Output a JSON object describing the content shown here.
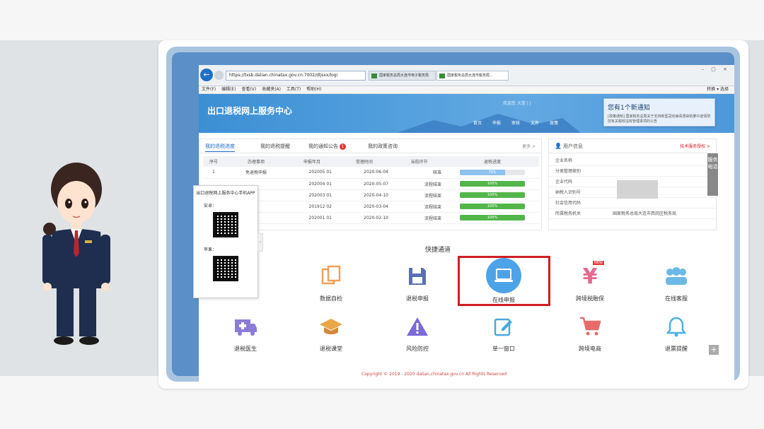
{
  "browser": {
    "url": "https://txsb.dalian.chinatax.gov.cn:7002/dljsxx/logi",
    "tabs": [
      "国家税务总局大连市电子税务局",
      "国家税务总局大连市税务局..."
    ],
    "menu": [
      "文件(F)",
      "编辑(E)",
      "查看(V)",
      "收藏夹(A)",
      "工具(T)",
      "帮助(H)"
    ],
    "menu_right": "转换 ▾  选择"
  },
  "site": {
    "title": "出口退税网上服务中心",
    "header_links": "欢迎您    大连    |    |    ",
    "nav": [
      "首页",
      "申报",
      "审核",
      "文件",
      "政策"
    ]
  },
  "notify": {
    "title": "您有1个新通知",
    "body": "[政策通知] 国家税务总局关于支持新型冠状病毒感染的肺炎疫情防控有关税收征收管理事项的公告"
  },
  "progress": {
    "tabs": [
      "我的退税进度",
      "我的退税提醒",
      "我的通知公告",
      "我的政策咨询"
    ],
    "badge": "1",
    "more": "更多 >",
    "headers": [
      "序号",
      "办理事项",
      "申报年月",
      "受理时间",
      "当前环节",
      "退税进度"
    ],
    "rows": [
      {
        "no": "1",
        "item": "免退税申报",
        "ym": "202005 01",
        "date": "2020-06-04",
        "stage": "核准",
        "pct": 70,
        "pct_label": "70%"
      },
      {
        "no": "",
        "item": "",
        "ym": "202004 01",
        "date": "2020-05-07",
        "stage": "流程结束",
        "pct": 100,
        "pct_label": "100%"
      },
      {
        "no": "",
        "item": "",
        "ym": "202003 01",
        "date": "2020-04-10",
        "stage": "流程结束",
        "pct": 100,
        "pct_label": "100%"
      },
      {
        "no": "",
        "item": "",
        "ym": "201912 02",
        "date": "2020-03-04",
        "stage": "流程结束",
        "pct": 100,
        "pct_label": "100%"
      },
      {
        "no": "",
        "item": "",
        "ym": "202001 01",
        "date": "2020-02-10",
        "stage": "流程结束",
        "pct": 100,
        "pct_label": "100%"
      }
    ]
  },
  "user": {
    "title": "用户信息",
    "link": "技术服务授权 >",
    "fields": [
      {
        "label": "企业名称",
        "value": ""
      },
      {
        "label": "分类管理类别",
        "value": ""
      },
      {
        "label": "企业代码",
        "value": ""
      },
      {
        "label": "纳税人识别号",
        "value": ""
      },
      {
        "label": "社会信用代码",
        "value": ""
      },
      {
        "label": "所属税务机关",
        "value": "国家税务总局大连市西岗区税务局"
      }
    ]
  },
  "side_tab": "服务电话",
  "qr": {
    "title": "出口退税网上服务中心手机APP",
    "android": "安卓：",
    "apple": "苹果："
  },
  "quick": {
    "title": "快捷通道",
    "items": [
      {
        "label": "数据自检",
        "icon": "copy-icon",
        "color": "#f0a25b"
      },
      {
        "label": "退税申报",
        "icon": "floppy-icon",
        "color": "#5a6fb0"
      },
      {
        "label": "在线申报",
        "icon": "laptop-icon",
        "color": "#4da3e8"
      },
      {
        "label": "跨境税融保",
        "icon": "yuan-icon",
        "color": "#e56a8d"
      },
      {
        "label": "在线客服",
        "icon": "people-icon",
        "color": "#6cb8e6"
      },
      {
        "label": "退税医生",
        "icon": "ambulance-icon",
        "color": "#8c7ad8"
      },
      {
        "label": "退税课堂",
        "icon": "graduation-cap-icon",
        "color": "#e8a848"
      },
      {
        "label": "风险防控",
        "icon": "warning-icon",
        "color": "#7c6ad6"
      },
      {
        "label": "单一窗口",
        "icon": "edit-icon",
        "color": "#4aa8dd"
      },
      {
        "label": "跨境电商",
        "icon": "cart-icon",
        "color": "#e86a6a"
      },
      {
        "label": "退票提醒",
        "icon": "bell-icon",
        "color": "#4ab1e6"
      }
    ],
    "new_badge": "NEW"
  },
  "footer": "Copyright © 2019 - 2020 dalian.chinatax.gov.cn All Rights Reserved"
}
